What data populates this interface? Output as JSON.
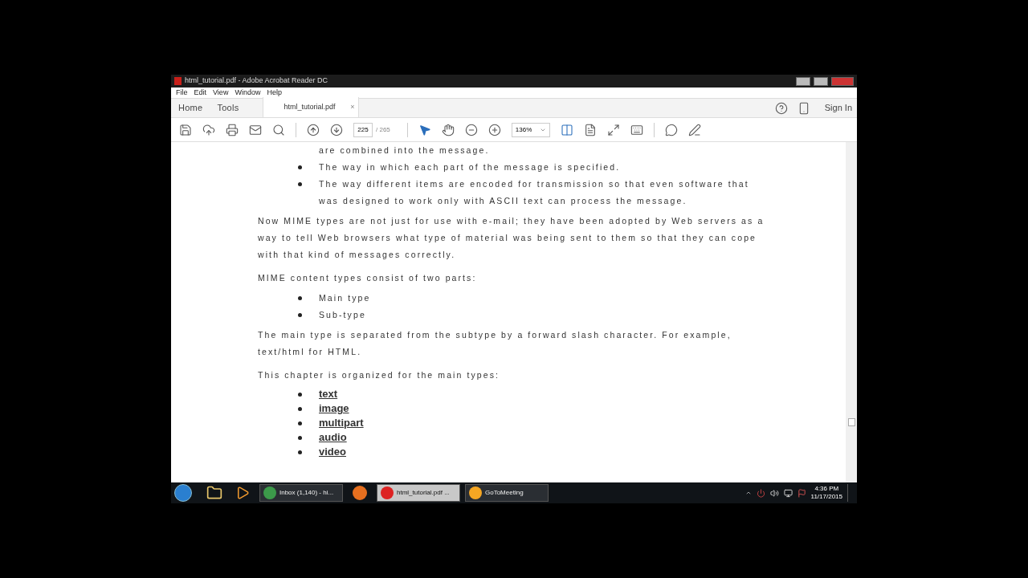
{
  "window": {
    "title": "html_tutorial.pdf - Adobe Acrobat Reader DC"
  },
  "menu": [
    "File",
    "Edit",
    "View",
    "Window",
    "Help"
  ],
  "nav_tabs": [
    {
      "label": "Home",
      "selected": false
    },
    {
      "label": "Tools",
      "selected": false
    }
  ],
  "doc_tab": {
    "label": "html_tutorial.pdf",
    "close": "×",
    "selected": true
  },
  "sign_in": "Sign In",
  "toolbar": {
    "page": "225",
    "page_total": "/ 265",
    "zoom": "136%"
  },
  "document": [
    {
      "kind": "bullet",
      "text": "are combined into the message."
    },
    {
      "kind": "bullet",
      "text": "The way in which each part of the message is specified.",
      "dot": true
    },
    {
      "kind": "bullet",
      "text": "The way different items are encoded for transmission so that even software that was designed to work only with ASCII text can process the message.",
      "dot": true
    },
    {
      "kind": "para",
      "text": "Now MIME types are not just for use with e-mail; they have been adopted by Web servers as a way to tell Web browsers what type of material was being sent to them so that they can cope with that kind of messages correctly."
    },
    {
      "kind": "para",
      "text": "MIME content types consist of two parts:"
    },
    {
      "kind": "bullet",
      "text": "Main type",
      "dot": true
    },
    {
      "kind": "bullet",
      "text": "Sub-type",
      "dot": true
    },
    {
      "kind": "para",
      "text": "The main type is separated from the subtype by a forward slash character. For example, text/html for HTML."
    },
    {
      "kind": "para",
      "text": "This chapter is organized for the main types:"
    },
    {
      "kind": "link",
      "text": "text"
    },
    {
      "kind": "link",
      "text": "image"
    },
    {
      "kind": "link",
      "text": "multipart"
    },
    {
      "kind": "link",
      "text": "audio"
    },
    {
      "kind": "link",
      "text": "video"
    }
  ],
  "taskbar": [
    {
      "label": "Inbox (1,140) - hi...",
      "kind": "chrome",
      "selected": false
    },
    {
      "kind": "firefox",
      "selected": false
    },
    {
      "label": "html_tutorial.pdf ...",
      "kind": "pdf",
      "selected": true
    },
    {
      "label": "GoToMeeting",
      "kind": "meeting",
      "selected": false
    }
  ],
  "clock": {
    "time": "4:36 PM",
    "date": "11/17/2015"
  }
}
